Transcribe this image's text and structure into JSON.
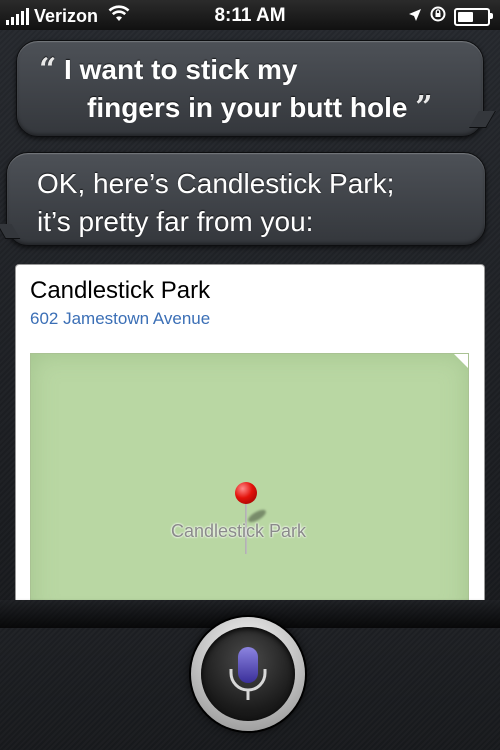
{
  "status_bar": {
    "carrier": "Verizon",
    "time": "8:11 AM",
    "battery_level": 0.55
  },
  "icons": {
    "signal": "signal-bars-icon",
    "wifi": "wifi-icon",
    "location": "location-arrow-icon",
    "lock": "rotation-lock-icon",
    "battery": "battery-icon",
    "mic": "microphone-icon",
    "pin": "map-pin-icon"
  },
  "conversation": {
    "user_line1": "I want to stick my",
    "user_line2": "fingers in your butt hole",
    "siri_reply": "OK, here’s Candlestick Park;\nit’s pretty far from you:",
    "open_quote": "“",
    "close_quote": "”"
  },
  "map_card": {
    "place_name": "Candlestick Park",
    "address": "602 Jamestown Avenue",
    "map_label": "Candlestick Park"
  },
  "colors": {
    "address_blue": "#3b6fb6",
    "map_green": "#b9d7a3",
    "pin_red": "#e3120b",
    "mic_purple": "#5a4db8"
  }
}
